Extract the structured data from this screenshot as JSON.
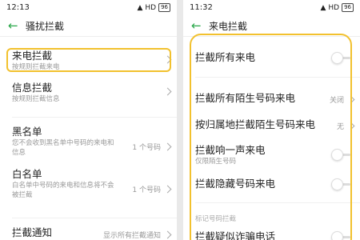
{
  "left": {
    "status": {
      "time": "12:13",
      "signal": "▲",
      "hd": "HD",
      "battery": "96"
    },
    "header": {
      "title": "骚扰拦截"
    },
    "items": [
      {
        "title": "来电拦截",
        "sub": "按规则拦截来电"
      },
      {
        "title": "信息拦截",
        "sub": "按规则拦截信息"
      },
      {
        "title": "黑名单",
        "sub1": "您不会收到黑名单中号码的来电和",
        "sub2": "信息",
        "value": "1 个号码"
      },
      {
        "title": "白名单",
        "sub1": "白名单中号码的来电和信息将不会",
        "sub2": "被拦截",
        "value": "1 个号码"
      },
      {
        "title": "拦截通知",
        "value": "显示所有拦截通知"
      }
    ]
  },
  "right": {
    "status": {
      "time": "11:32",
      "signal": "▲",
      "hd": "HD",
      "battery": "96"
    },
    "header": {
      "title": "来电拦截"
    },
    "items": [
      {
        "title": "拦截所有来电"
      },
      {
        "title": "拦截所有陌生号码来电",
        "value": "关闭"
      },
      {
        "title": "按归属地拦截陌生号码来电",
        "value": "无"
      },
      {
        "title": "拦截响一声来电",
        "sub": "仅限陌生号码"
      },
      {
        "title": "拦截隐藏号码来电"
      },
      {
        "title": "拦截疑似诈骗电话"
      }
    ],
    "section_label": "标记号码拦截"
  },
  "colors": {
    "accent_green": "#2aa84a",
    "highlight_yellow": "#f2c12e"
  }
}
